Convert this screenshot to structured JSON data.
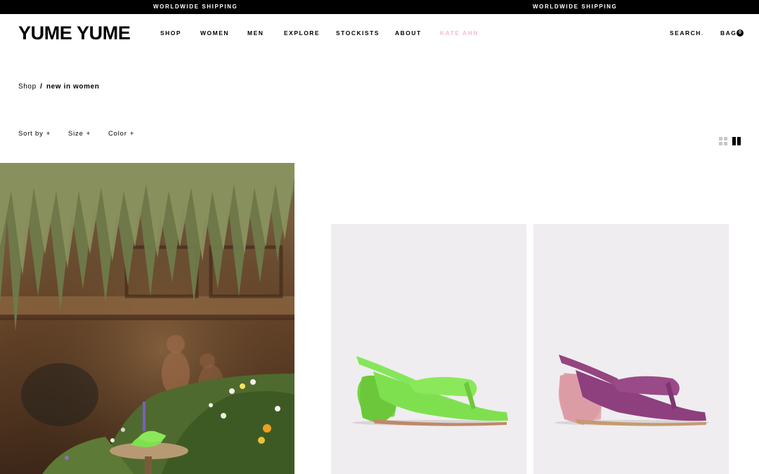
{
  "ticker": {
    "items": [
      "WORLDWIDE SHIPPING",
      "WORLDWIDE SHIPPING"
    ]
  },
  "header": {
    "logo": "YUME YUME",
    "nav": [
      "SHOP",
      "WOMEN",
      "MEN",
      "EXPLORE",
      "STOCKISTS",
      "ABOUT",
      "KATE AHN"
    ],
    "search_label": "SEARCH",
    "bag_label": "BAG",
    "bag_count": "0",
    "colors": {
      "highlight_nav": "#f3bdd2"
    }
  },
  "breadcrumb": {
    "root": "Shop",
    "separator": "/",
    "current": "new in women"
  },
  "filters": {
    "sort": "Sort by",
    "size": "Size",
    "color": "Color",
    "expand_symbol": "+"
  },
  "view_options": {
    "icons": [
      "grid-4-icon",
      "grid-2-icon"
    ],
    "selected": "grid-2-icon"
  },
  "products": [
    {
      "color_name": "green",
      "shoe_color": "#7fe04f",
      "heel_color": "#6fcd3a"
    },
    {
      "color_name": "purple",
      "shoe_color": "#8e3f7e",
      "heel_color": "#e6aab2"
    }
  ]
}
